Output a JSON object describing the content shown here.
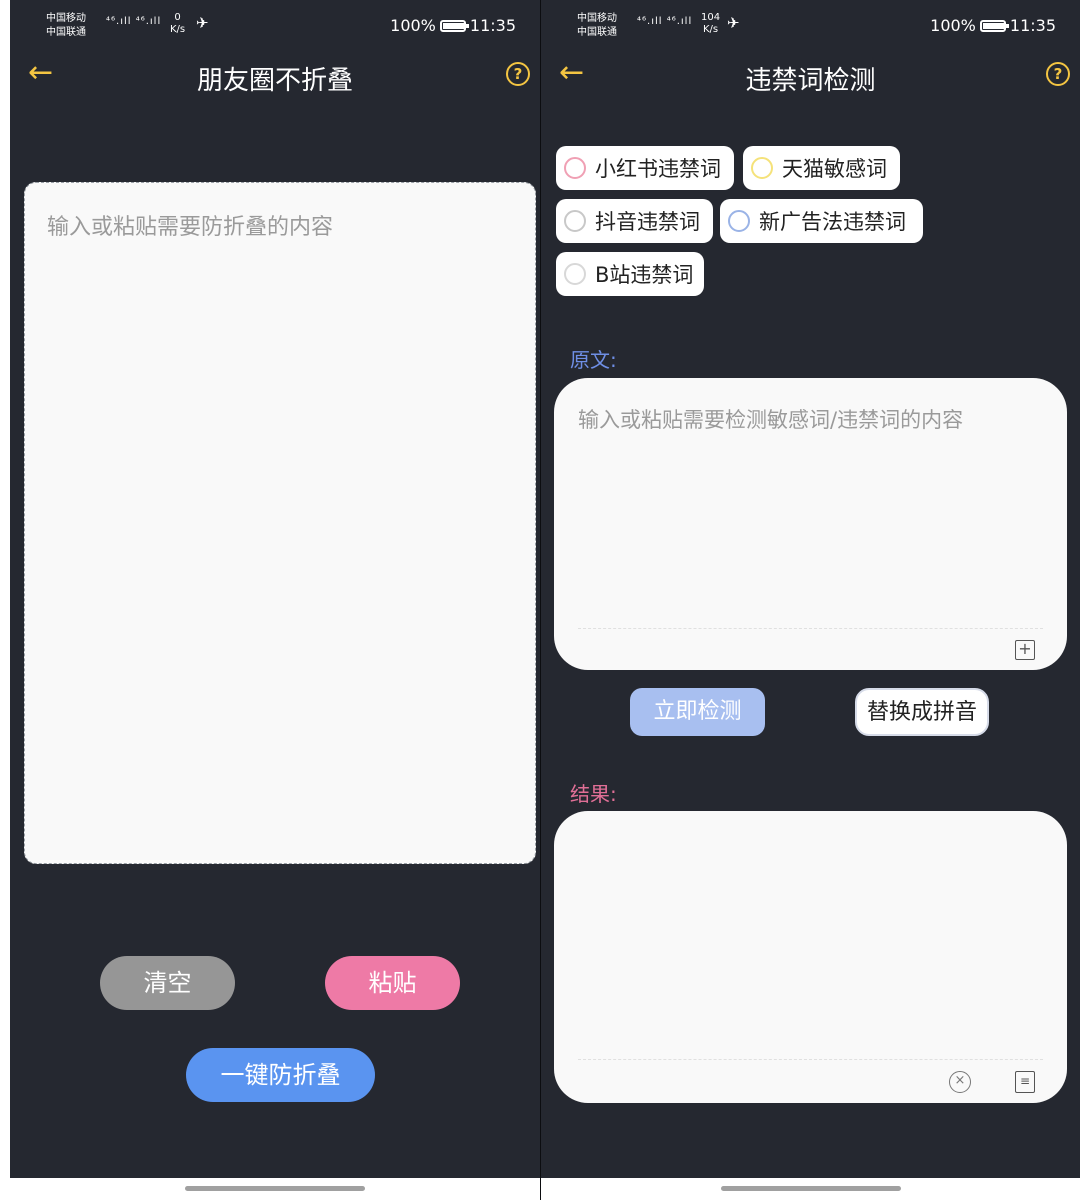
{
  "status": {
    "carrier1": "中国移动",
    "carrier2": "中国联通",
    "signal": "⁴⁶.ıll ⁴⁶.ıll",
    "speed_left": "0",
    "speed_right": "104",
    "speed_unit": "K/s",
    "battery": "100%",
    "time": "11:35"
  },
  "left": {
    "title": "朋友圈不折叠",
    "placeholder": "输入或粘贴需要防折叠的内容",
    "clear_label": "清空",
    "paste_label": "粘贴",
    "fold_label": "一键防折叠"
  },
  "right": {
    "title": "违禁词检测",
    "chips": [
      {
        "label": "小红书违禁词",
        "radio_color": "#f0a0b4"
      },
      {
        "label": "天猫敏感词",
        "radio_color": "#f5e27a"
      },
      {
        "label": "抖音违禁词",
        "radio_color": "#c8c8c8"
      },
      {
        "label": "新广告法违禁词",
        "radio_color": "#9ab3e6"
      },
      {
        "label": "B站违禁词",
        "radio_color": "#d8d8d8"
      }
    ],
    "original_label": "原文:",
    "original_placeholder": "输入或粘贴需要检测敏感词/违禁词的内容",
    "detect_label": "立即检测",
    "pinyin_label": "替换成拼音",
    "result_label": "结果:"
  },
  "icons": {
    "back": "arrow-left-icon",
    "help": "question-circle-icon",
    "paste": "paste-icon",
    "clear": "clear-circle-icon",
    "copy": "copy-icon"
  },
  "colors": {
    "background": "#252830",
    "accent_yellow": "#f4c542",
    "clear_button": "#969696",
    "paste_button": "#ee7aa6",
    "fold_button": "#5a94f0",
    "detect_button": "#a8bff0"
  }
}
